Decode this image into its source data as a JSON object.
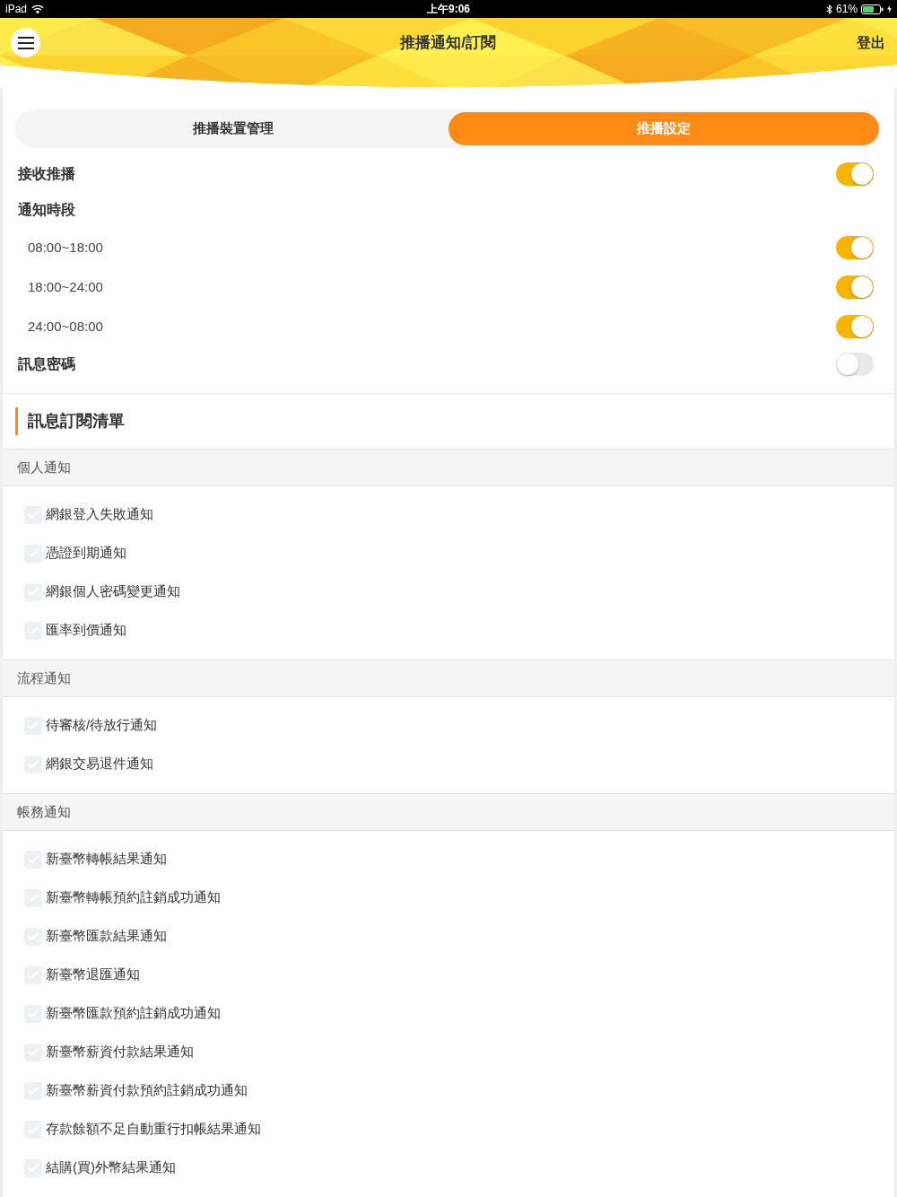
{
  "status_bar": {
    "device": "iPad",
    "time": "上午9:06",
    "battery": "61%"
  },
  "header": {
    "title": "推播通知/訂閱",
    "logout": "登出"
  },
  "tabs": [
    {
      "label": "推播裝置管理",
      "selected": false
    },
    {
      "label": "推播設定",
      "selected": true
    }
  ],
  "settings": [
    {
      "kind": "toggle",
      "label": "接收推播",
      "on": true
    },
    {
      "kind": "heading",
      "label": "通知時段"
    },
    {
      "kind": "sub_toggle",
      "label": "08:00~18:00",
      "on": true
    },
    {
      "kind": "sub_toggle",
      "label": "18:00~24:00",
      "on": true
    },
    {
      "kind": "sub_toggle",
      "label": "24:00~08:00",
      "on": true
    },
    {
      "kind": "toggle",
      "label": "訊息密碼",
      "on": false
    }
  ],
  "subscription": {
    "title": "訊息訂閱清單",
    "groups": [
      {
        "title": "個人通知",
        "items": [
          {
            "label": "網銀登入失敗通知",
            "checked": false
          },
          {
            "label": "憑證到期通知",
            "checked": false
          },
          {
            "label": "網銀個人密碼變更通知",
            "checked": false
          },
          {
            "label": "匯率到價通知",
            "checked": false
          }
        ]
      },
      {
        "title": "流程通知",
        "items": [
          {
            "label": "待審核/待放行通知",
            "checked": false
          },
          {
            "label": "網銀交易退件通知",
            "checked": false
          }
        ]
      },
      {
        "title": "帳務通知",
        "items": [
          {
            "label": "新臺幣轉帳結果通知",
            "checked": false
          },
          {
            "label": "新臺幣轉帳預約註銷成功通知",
            "checked": false
          },
          {
            "label": "新臺幣匯款結果通知",
            "checked": false
          },
          {
            "label": "新臺幣退匯通知",
            "checked": false
          },
          {
            "label": "新臺幣匯款預約註銷成功通知",
            "checked": false
          },
          {
            "label": "新臺幣薪資付款結果通知",
            "checked": false
          },
          {
            "label": "新臺幣薪資付款預約註銷成功通知",
            "checked": false
          },
          {
            "label": "存款餘額不足自動重行扣帳結果通知",
            "checked": false
          },
          {
            "label": "結購(買)外幣結果通知",
            "checked": false
          }
        ]
      }
    ]
  }
}
